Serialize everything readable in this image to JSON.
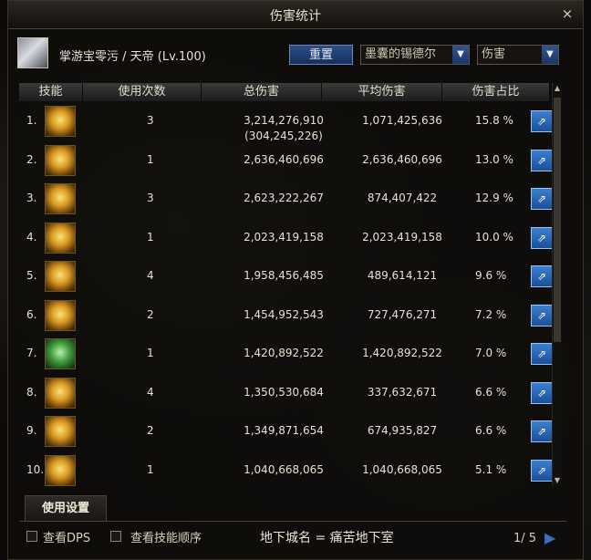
{
  "window": {
    "title": "伤害统计",
    "close_icon": "×"
  },
  "character": {
    "name": "掌游宝零污 / 天帝 (Lv.100)"
  },
  "controls": {
    "reset_label": "重置",
    "target_dropdown": "墨囊的锡德尔",
    "type_dropdown": "伤害",
    "dropdown_arrow": "▼"
  },
  "table": {
    "headers": [
      "技能",
      "使用次数",
      "总伤害",
      "平均伤害",
      "伤害占比"
    ],
    "rows": [
      {
        "index": "1.",
        "count": "3",
        "total": "3,214,276,910",
        "total_extra": "(304,245,226)",
        "avg": "1,071,425,636",
        "pct": "15.8 %"
      },
      {
        "index": "2.",
        "count": "1",
        "total": "2,636,460,696",
        "avg": "2,636,460,696",
        "pct": "13.0 %"
      },
      {
        "index": "3.",
        "count": "3",
        "total": "2,623,222,267",
        "avg": "874,407,422",
        "pct": "12.9 %"
      },
      {
        "index": "4.",
        "count": "1",
        "total": "2,023,419,158",
        "avg": "2,023,419,158",
        "pct": "10.0 %"
      },
      {
        "index": "5.",
        "count": "4",
        "total": "1,958,456,485",
        "avg": "489,614,121",
        "pct": "9.6 %"
      },
      {
        "index": "6.",
        "count": "2",
        "total": "1,454,952,543",
        "avg": "727,476,271",
        "pct": "7.2 %"
      },
      {
        "index": "7.",
        "count": "1",
        "total": "1,420,892,522",
        "avg": "1,420,892,522",
        "pct": "7.0 %"
      },
      {
        "index": "8.",
        "count": "4",
        "total": "1,350,530,684",
        "avg": "337,632,671",
        "pct": "6.6 %"
      },
      {
        "index": "9.",
        "count": "2",
        "total": "1,349,871,654",
        "avg": "674,935,827",
        "pct": "6.6 %"
      },
      {
        "index": "10.",
        "count": "1",
        "total": "1,040,668,065",
        "avg": "1,040,668,065",
        "pct": "5.1 %"
      }
    ],
    "export_icon": "export-icon"
  },
  "footer": {
    "tab_label": "使用设置",
    "show_dps": "查看DPS",
    "show_skill_order": "查看技能顺序",
    "dungeon_name": "地下城名 = 痛苦地下室",
    "page": "1/ 5",
    "next_arrow": "▶"
  }
}
